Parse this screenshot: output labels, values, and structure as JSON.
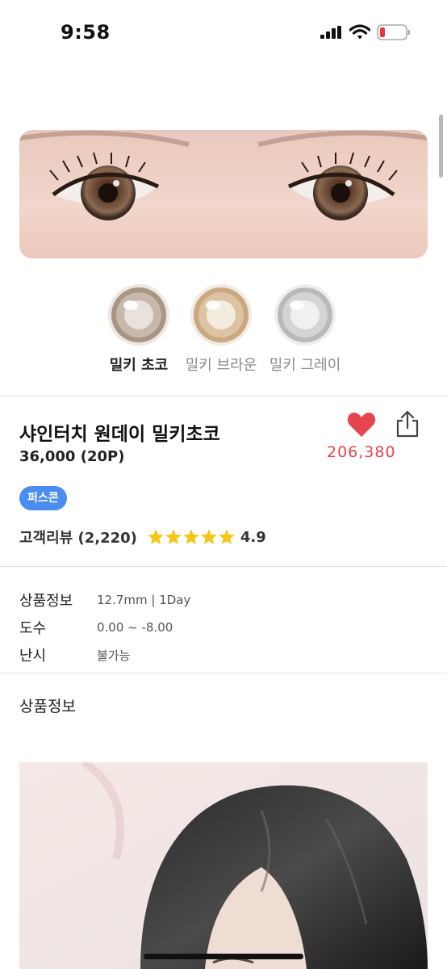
{
  "status_bar": {
    "time": "9:58"
  },
  "swatches": [
    {
      "label": "밀키 초코",
      "selected": true,
      "color": "#b9a595"
    },
    {
      "label": "밀키 브라운",
      "selected": false,
      "color": "#cfb48f"
    },
    {
      "label": "밀키 그레이",
      "selected": false,
      "color": "#c4c4c4"
    }
  ],
  "product": {
    "title": "샤인터치 원데이 밀키초코",
    "price": "36,000 (20P)",
    "like_count": "206,380",
    "badge": "퍼스콘"
  },
  "review": {
    "label": "고객리뷰 (2,220)",
    "rating": "4.9",
    "stars": 5
  },
  "specs": [
    {
      "label": "상품정보",
      "value": "12.7mm | 1Day"
    },
    {
      "label": "도수",
      "value": "0.00 ~ -8.00"
    },
    {
      "label": "난시",
      "value": "불가능"
    }
  ],
  "section": {
    "title": "상품정보"
  },
  "colors": {
    "accent_red": "#e6454f",
    "badge_blue": "#4a8df1",
    "star_yellow": "#f5c518"
  }
}
